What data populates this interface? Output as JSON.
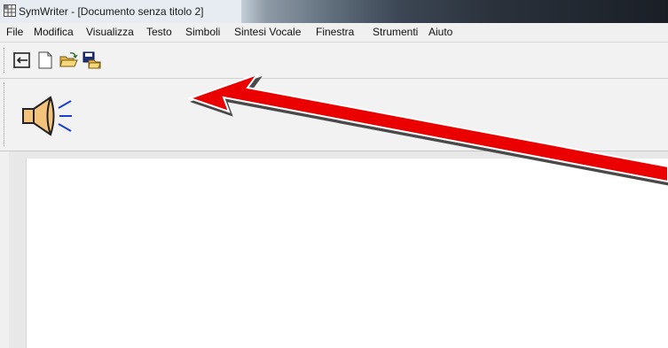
{
  "window": {
    "title": "SymWriter - [Documento senza titolo 2]"
  },
  "menu": {
    "items": [
      {
        "label": "File"
      },
      {
        "label": "Modifica"
      },
      {
        "label": "Visualizza"
      },
      {
        "label": "Testo"
      },
      {
        "label": "Simboli"
      },
      {
        "label": "Sintesi Vocale"
      },
      {
        "label": "Finestra"
      },
      {
        "label": "Strumenti"
      },
      {
        "label": "Aiuto"
      }
    ]
  },
  "toolbar": {
    "buttons": [
      {
        "icon": "exit-icon"
      },
      {
        "icon": "new-document-icon"
      },
      {
        "icon": "open-folder-icon"
      },
      {
        "icon": "save-as-icon"
      }
    ]
  },
  "speech_bar": {
    "icon": "speaker-icon"
  },
  "annotation": {
    "color": "#e60000",
    "icon": "red-arrow"
  }
}
